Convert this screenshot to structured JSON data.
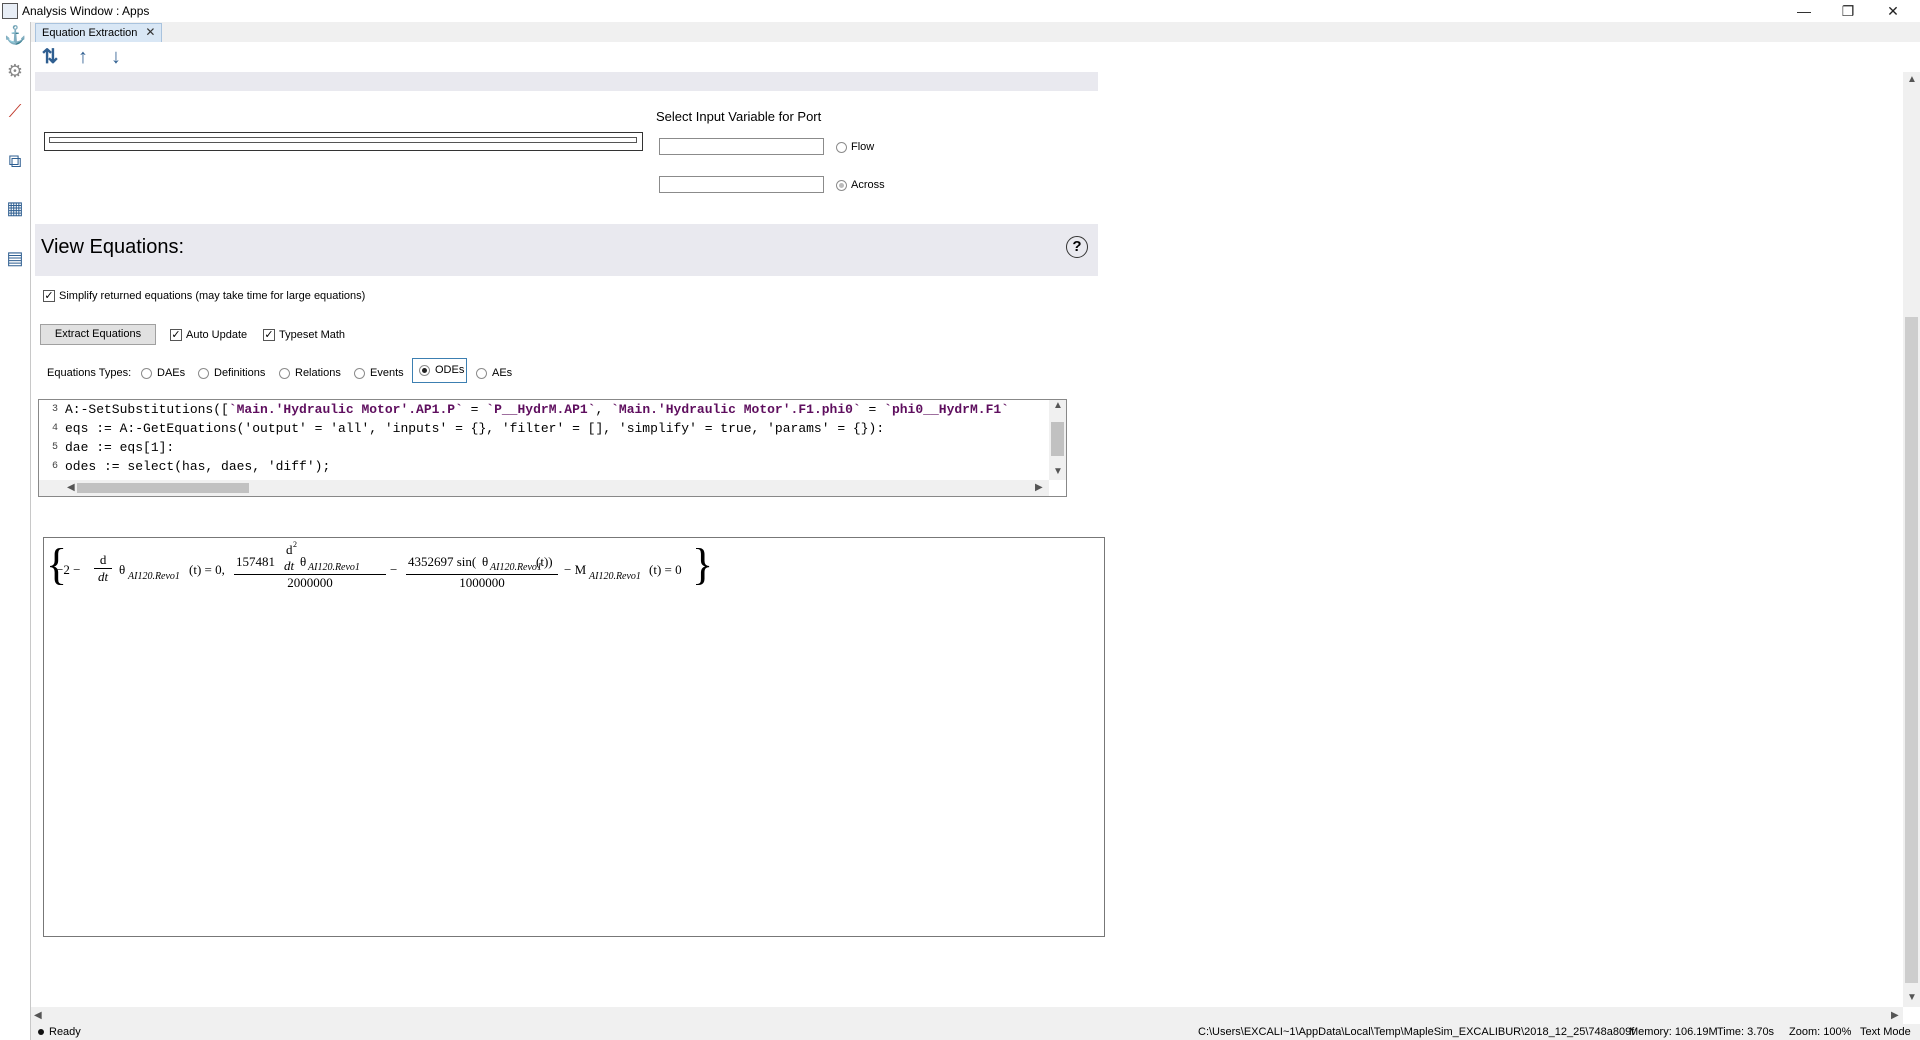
{
  "window": {
    "title": "Analysis Window : Apps",
    "controls": {
      "minimize": "—",
      "restore": "❐",
      "close": "✕"
    }
  },
  "tab": {
    "label": "Equation Extraction",
    "close": "✕"
  },
  "port_section": {
    "label": "Select Input Variable for Port",
    "flow_label": "Flow",
    "across_label": "Across",
    "selected": "Across"
  },
  "view_equations": {
    "title": "View Equations:",
    "help": "?",
    "simplify_label": "Simplify returned equations (may take time for large equations)",
    "simplify_checked": true,
    "extract_button": "Extract Equations",
    "auto_update_label": "Auto Update",
    "auto_update_checked": true,
    "typeset_math_label": "Typeset Math",
    "typeset_math_checked": true,
    "types_label": "Equations Types:",
    "types": [
      "DAEs",
      "Definitions",
      "Relations",
      "Events",
      "ODEs",
      "AEs"
    ],
    "selected_type": "ODEs"
  },
  "code_editor": {
    "lines": [
      {
        "number": "3",
        "parts": [
          {
            "t": "A:-SetSubstitutions([",
            "s": false
          },
          {
            "t": "`Main.'Hydraulic Motor'.AP1.P`",
            "s": true
          },
          {
            "t": " = ",
            "s": false
          },
          {
            "t": "`P__HydrM.AP1`",
            "s": true
          },
          {
            "t": ", ",
            "s": false
          },
          {
            "t": "`Main.'Hydraulic Motor'.F1.phi0`",
            "s": true
          },
          {
            "t": " = ",
            "s": false
          },
          {
            "t": "`phi0__HydrM.F1`",
            "s": true
          }
        ]
      },
      {
        "number": "4",
        "parts": [
          {
            "t": "eqs := A:-GetEquations('output' = 'all', 'inputs' = {}, 'filter' = [], 'simplify' = true, 'params' = {}):",
            "s": false
          }
        ]
      },
      {
        "number": "5",
        "parts": [
          {
            "t": "dae := eqs[1]:",
            "s": false
          }
        ]
      },
      {
        "number": "6",
        "parts": [
          {
            "t": "odes := select(has, daes, 'diff');",
            "s": false
          }
        ]
      }
    ]
  },
  "math_output": {
    "open_brace": "{",
    "close_brace": "}",
    "t1_lead": "−2 −",
    "d": "d",
    "dt": "dt",
    "theta": "θ",
    "sub": "AI120.Revo1",
    "of_t": "(t) = 0,",
    "c1_num": "157481",
    "d2": "d",
    "sup2": "2",
    "dt2": "dt",
    "c1_den": "2000000",
    "minus": "−",
    "c2_num": "4352697 sin(",
    "c2_tail": "(t))",
    "c2_den": "1000000",
    "m_lead": "− M",
    "end": "(t) = 0"
  },
  "status": {
    "state": "Ready",
    "path": "C:\\Users\\EXCALI~1\\AppData\\Local\\Temp\\MapleSim_EXCALIBUR\\2018_12_25\\748a809f",
    "memory": "Memory: 106.19M",
    "time": "Time: 3.70s",
    "zoom": "Zoom: 100%",
    "mode": "Text Mode"
  }
}
